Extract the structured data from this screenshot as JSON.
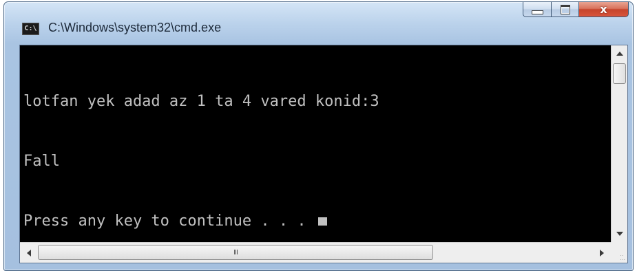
{
  "window": {
    "title": "C:\\Windows\\system32\\cmd.exe",
    "app_icon_label": "C:\\"
  },
  "caption_buttons": {
    "minimize_icon": "minimize-icon",
    "maximize_icon": "maximize-icon",
    "close_icon": "close-icon",
    "close_glyph": "x",
    "close_color": "#c6432b"
  },
  "console": {
    "lines": [
      "lotfan yek adad az 1 ta 4 vared konid:3",
      "Fall",
      "Press any key to continue . . . "
    ],
    "background": "#000000",
    "foreground": "#c0c0c0"
  },
  "scrollbars": {
    "horizontal_grip": "III"
  }
}
